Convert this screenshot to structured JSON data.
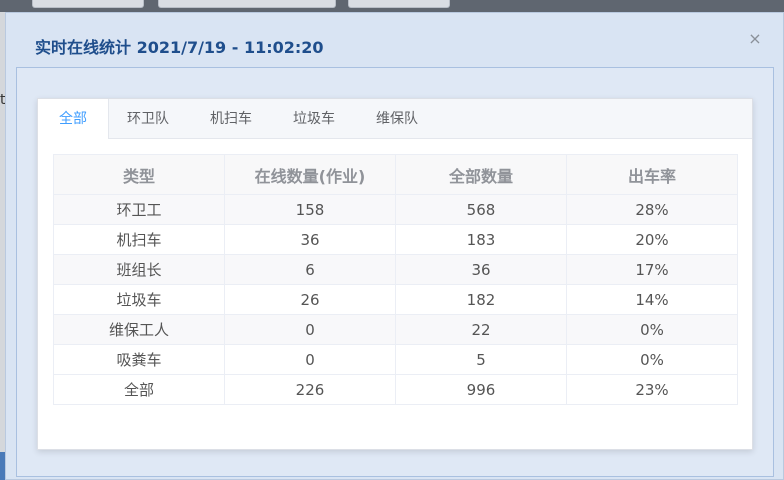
{
  "dialog": {
    "title": "实时在线统计 2021/7/19 - 11:02:20",
    "close_glyph": "×"
  },
  "background": {
    "left_char": "t"
  },
  "tabs": [
    {
      "label": "全部",
      "active": true
    },
    {
      "label": "环卫队",
      "active": false
    },
    {
      "label": "机扫车",
      "active": false
    },
    {
      "label": "垃圾车",
      "active": false
    },
    {
      "label": "维保队",
      "active": false
    }
  ],
  "table": {
    "headers": [
      "类型",
      "在线数量(作业)",
      "全部数量",
      "出车率"
    ],
    "rows": [
      [
        "环卫工",
        "158",
        "568",
        "28%"
      ],
      [
        "机扫车",
        "36",
        "183",
        "20%"
      ],
      [
        "班组长",
        "6",
        "36",
        "17%"
      ],
      [
        "垃圾车",
        "26",
        "182",
        "14%"
      ],
      [
        "维保工人",
        "0",
        "22",
        "0%"
      ],
      [
        "吸粪车",
        "0",
        "5",
        "0%"
      ],
      [
        "全部",
        "226",
        "996",
        "23%"
      ]
    ]
  },
  "colors": {
    "title": "#1f4e8c",
    "tab_active": "#409eff",
    "header_text": "#909399"
  }
}
